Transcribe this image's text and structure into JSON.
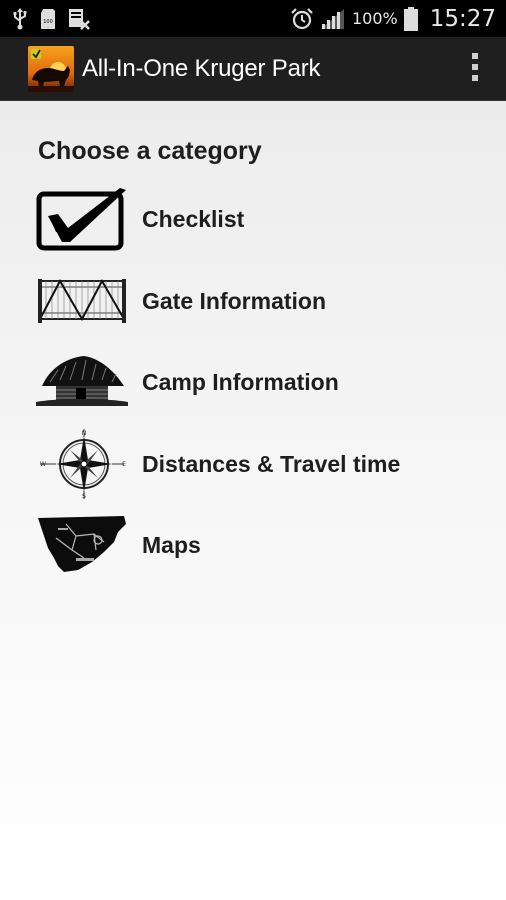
{
  "status_bar": {
    "left_icons": [
      "usb-icon",
      "sd-card-icon",
      "screenshot-icon"
    ],
    "right_icons": [
      "alarm-icon",
      "signal-icon",
      "battery-icon"
    ],
    "battery_percent": "100%",
    "time": "15:27"
  },
  "action_bar": {
    "title": "All-In-One Kruger Park",
    "app_icon": "rhino-sunset-app-icon",
    "overflow_icon": "overflow-menu-icon"
  },
  "main": {
    "heading": "Choose a category",
    "categories": [
      {
        "label": "Checklist",
        "icon": "checkbox-icon"
      },
      {
        "label": "Gate Information",
        "icon": "gate-icon"
      },
      {
        "label": "Camp Information",
        "icon": "hut-icon"
      },
      {
        "label": "Distances & Travel time",
        "icon": "compass-icon"
      },
      {
        "label": "Maps",
        "icon": "map-icon"
      }
    ]
  },
  "colors": {
    "status_bar_bg": "#000000",
    "action_bar_bg": "#1f1f1f",
    "text": "#1e1e1e"
  }
}
